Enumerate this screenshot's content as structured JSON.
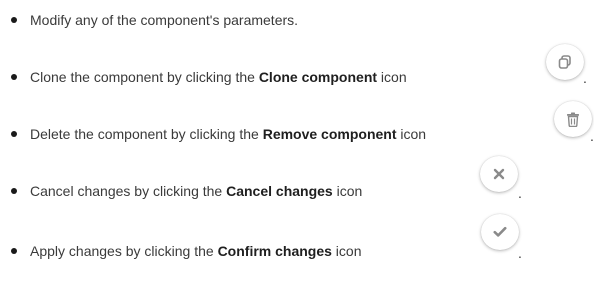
{
  "items": [
    {
      "text": "Modify any of the component's parameters."
    },
    {
      "prefix": "Clone the component by clicking the ",
      "bold": "Clone component",
      "suffix": " icon",
      "icon": "clone-icon",
      "trailing": "."
    },
    {
      "prefix": "Delete the component by clicking the ",
      "bold": "Remove component",
      "suffix": " icon",
      "icon": "trash-icon",
      "trailing": "."
    },
    {
      "prefix": "Cancel changes by clicking the ",
      "bold": "Cancel changes",
      "suffix": " icon",
      "icon": "close-icon",
      "trailing": "."
    },
    {
      "prefix": "Apply changes by clicking the ",
      "bold": "Confirm changes",
      "suffix": " icon",
      "icon": "check-icon",
      "trailing": "."
    }
  ],
  "colors": {
    "text": "#3a3a3a",
    "icon": "#8a8a8a"
  }
}
